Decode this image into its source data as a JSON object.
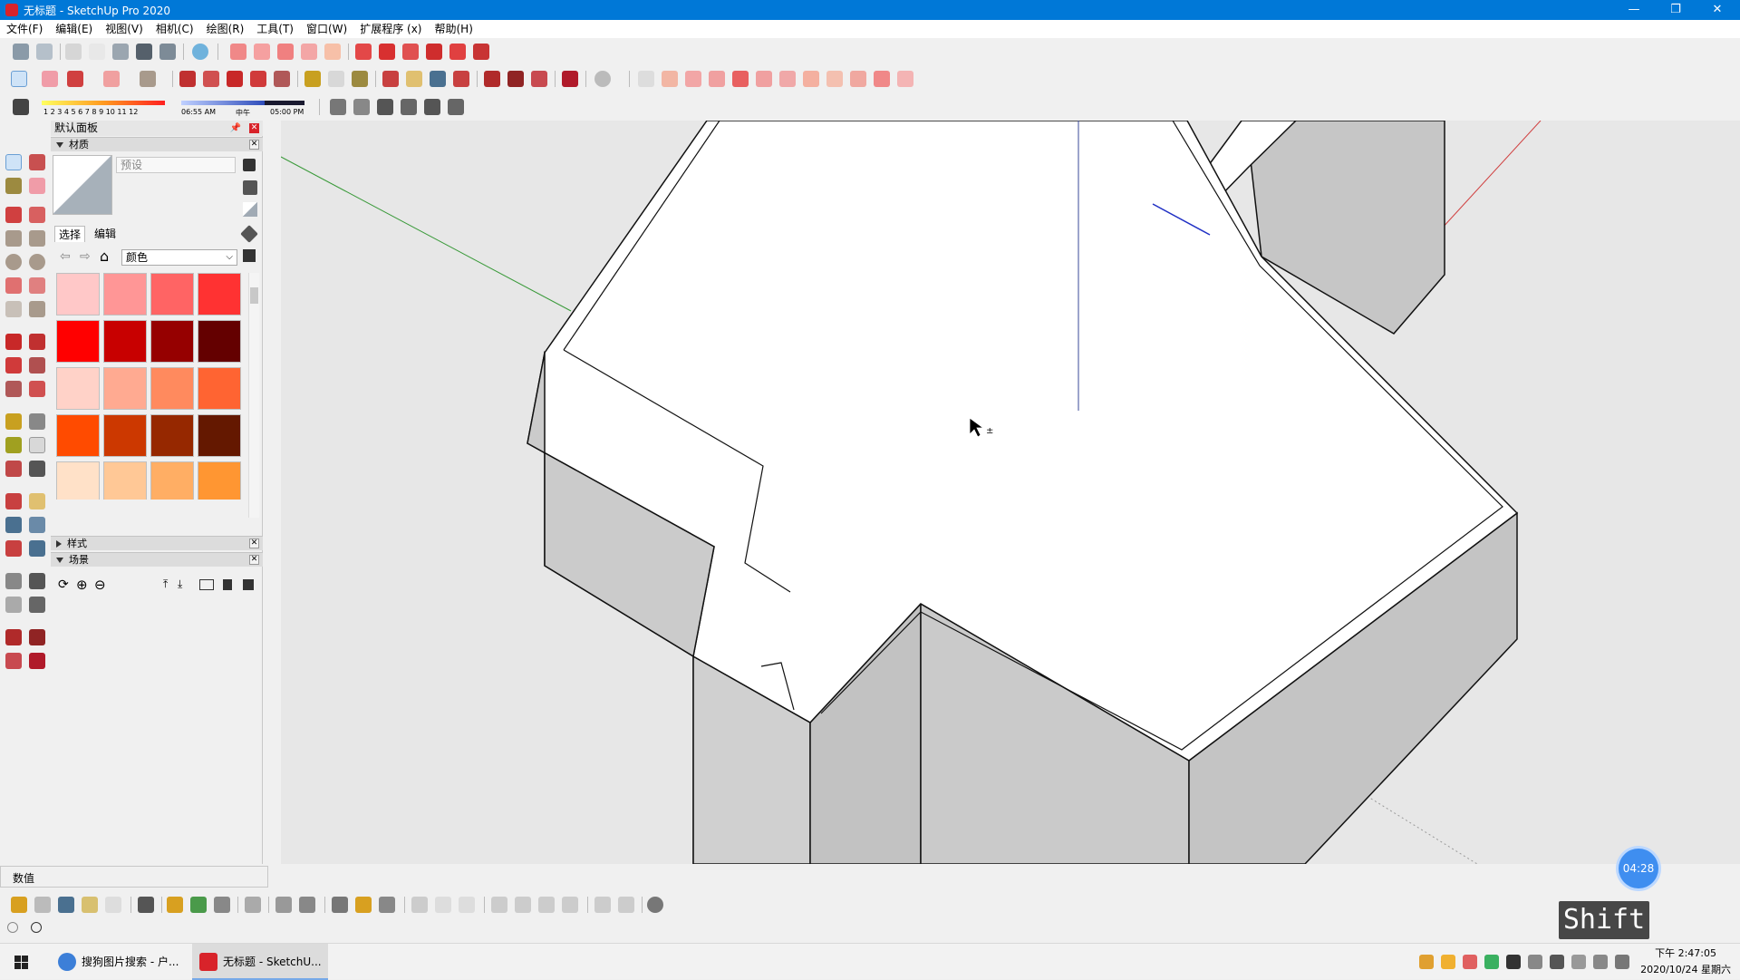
{
  "window": {
    "title": "无标题 - SketchUp Pro 2020",
    "minimize": "—",
    "restore": "❐",
    "close": "✕"
  },
  "menu": [
    "文件(F)",
    "编辑(E)",
    "视图(V)",
    "相机(C)",
    "绘图(R)",
    "工具(T)",
    "窗口(W)",
    "扩展程序 (x)",
    "帮助(H)"
  ],
  "shadow_strip": {
    "months": "1 2 3 4 5 6 7 8 9 10 11 12",
    "time_start": "06:55 AM",
    "noon": "中午",
    "time_end": "05:00 PM"
  },
  "tray": {
    "title": "默认面板",
    "materials_header": "材质",
    "material_name_placeholder": "预设",
    "tab_select": "选择",
    "tab_edit": "编辑",
    "collection": "颜色",
    "swatches": [
      "#ffc8c8",
      "#ff9696",
      "#ff6464",
      "#ff3232",
      "#ff0000",
      "#c80000",
      "#960000",
      "#640000",
      "#ffd2c8",
      "#ffaa91",
      "#ff8a5e",
      "#ff6432",
      "#ff4b00",
      "#cc3800",
      "#962800",
      "#641800",
      "#ffe1c8",
      "#ffc896",
      "#ffae64",
      "#ff9632",
      "#ff8000",
      "#cc6600",
      "#964b00",
      "#643200"
    ],
    "styles_header": "样式",
    "scenes_header": "场景"
  },
  "value_bar": {
    "label": "数值"
  },
  "timer": "04:28",
  "key_overlay": "Shift",
  "taskbar": {
    "items": [
      {
        "label": "搜狗图片搜索 - 户..."
      },
      {
        "label": "无标题 - SketchU..."
      }
    ],
    "clock_time": "下午 2:47:05",
    "clock_date": "2020/10/24 星期六"
  },
  "colors": {
    "titlebar": "#0078d7",
    "accent_red": "#d8232a",
    "viewport_bg": "#e7e7e7",
    "face_top": "#ffffff",
    "face_side": "#c8c8c8"
  }
}
